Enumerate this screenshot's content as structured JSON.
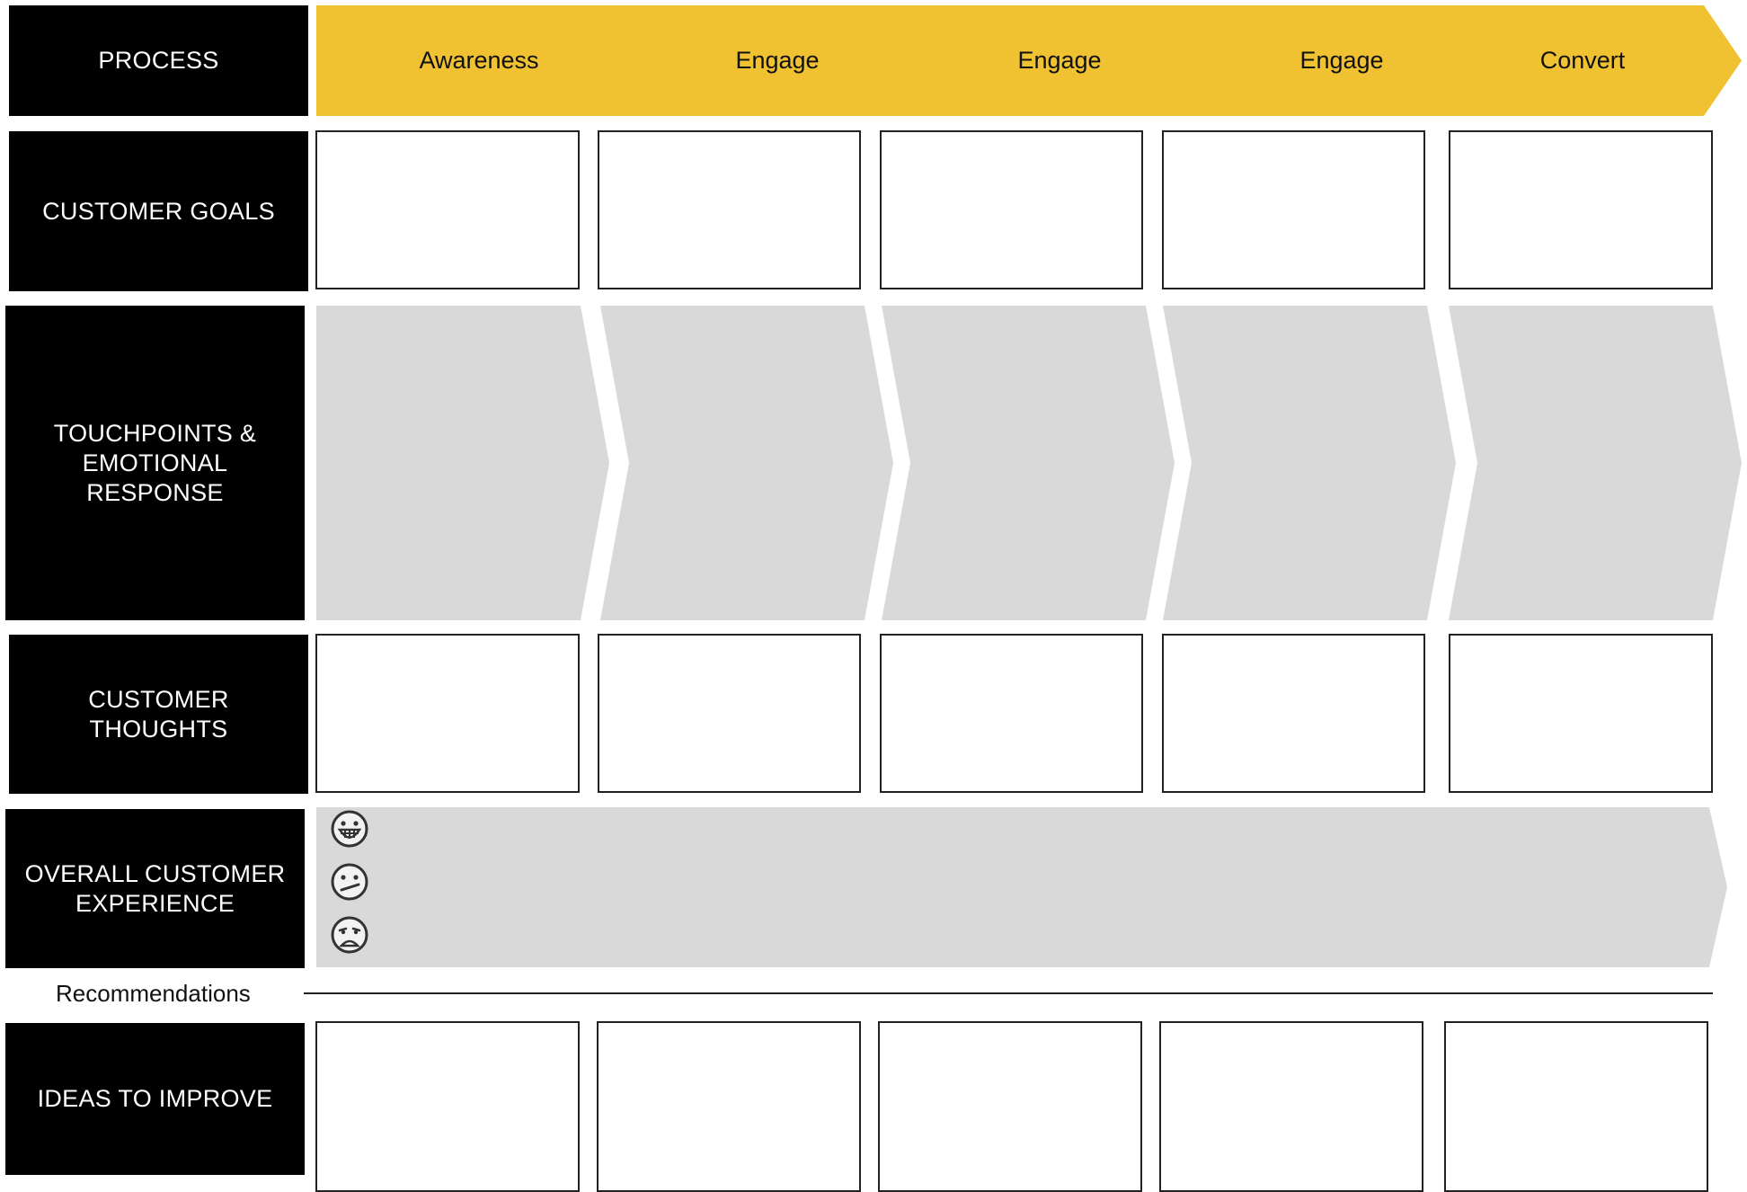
{
  "colors": {
    "accent": "#f0c231",
    "label_bg": "#000000",
    "touch_bg": "#d9d9d9"
  },
  "rows": {
    "process": "PROCESS",
    "customer_goals": "CUSTOMER GOALS",
    "touchpoints": "TOUCHPOINTS &\nEMOTIONAL\nRESPONSE",
    "customer_thoughts": "CUSTOMER\nTHOUGHTS",
    "overall_experience": "OVERALL CUSTOMER\nEXPERIENCE",
    "ideas": "IDEAS TO IMPROVE"
  },
  "stages": [
    "Awareness",
    "Engage",
    "Engage",
    "Engage",
    "Convert"
  ],
  "recommendations_label": "Recommendations",
  "experience_icons": [
    "grinning-face-icon",
    "confused-face-icon",
    "sad-face-icon"
  ]
}
